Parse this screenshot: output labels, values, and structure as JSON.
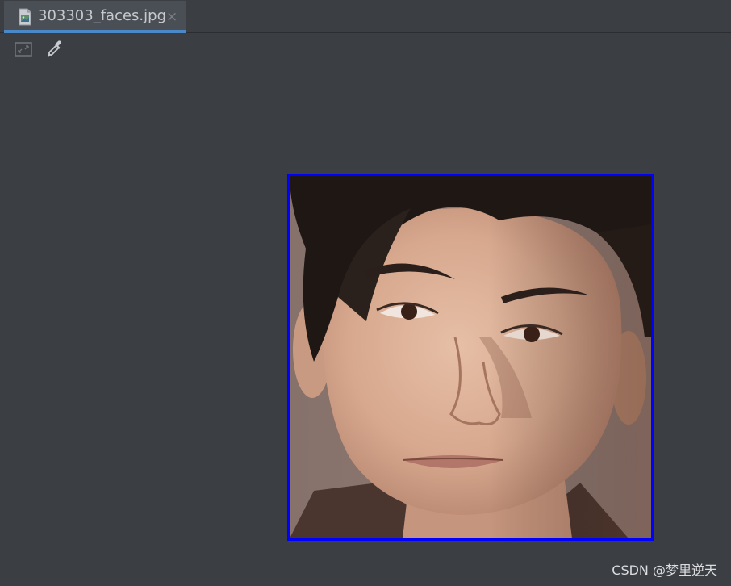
{
  "tab": {
    "title": "303303_faces.jpg",
    "close_glyph": "×",
    "icon": "image-file-icon",
    "active_color": "#4a88c7"
  },
  "toolbar": {
    "buttons": [
      {
        "icon": "fit-to-window-icon"
      },
      {
        "icon": "color-picker-icon"
      }
    ]
  },
  "image": {
    "subject": "portrait-photo",
    "border_color": "#0000ff"
  },
  "watermark": {
    "text": "CSDN @梦里逆天"
  },
  "colors": {
    "background": "#3b3f43",
    "tab_background": "#4a4f55"
  }
}
